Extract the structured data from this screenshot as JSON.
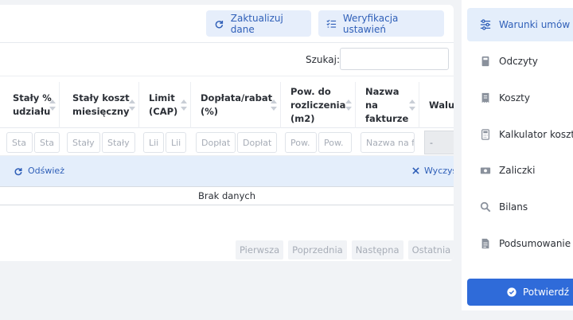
{
  "toolbar": {
    "update_label": "Zaktualizuj dane",
    "verify_label": "Weryfikacja ustawień"
  },
  "search": {
    "label": "Szukaj:",
    "value": "",
    "placeholder": ""
  },
  "table": {
    "columns": [
      "Stały %\nudziału",
      "Stały koszt\nmiesięczny",
      "Limit\n(CAP)",
      "Dopłata/rabat\n(%)",
      "Pow. do\nrozliczenia\n(m2)",
      "Nazwa\nna\nfakturze",
      "Waluta"
    ],
    "filter_placeholders": [
      "Sta",
      "Sta",
      "Stały",
      "Stały",
      "Lii",
      "Lii",
      "Dopłat",
      "Dopłat",
      "Pow.",
      "Pow.",
      "Nazwa na f"
    ],
    "currency_filter": "-",
    "refresh_label": "Odśwież",
    "clear_label": "Wyczyść f",
    "empty_label": "Brak danych",
    "pager": [
      "Pierwsza",
      "Poprzednia",
      "Następna",
      "Ostatnia"
    ]
  },
  "sidebar": {
    "items": [
      {
        "label": "Warunki umów",
        "icon": "sliders-icon"
      },
      {
        "label": "Odczyty",
        "icon": "meter-icon"
      },
      {
        "label": "Koszty",
        "icon": "receipt-icon"
      },
      {
        "label": "Kalkulator kosztów",
        "icon": "calculator-icon"
      },
      {
        "label": "Zaliczki",
        "icon": "money-icon"
      },
      {
        "label": "Bilans",
        "icon": "magnifier-icon"
      },
      {
        "label": "Podsumowanie",
        "icon": "document-icon"
      }
    ],
    "confirm_label": "Potwierdź i"
  },
  "colors": {
    "accent": "#2f6bd9",
    "accent_soft": "#e4eefb"
  }
}
